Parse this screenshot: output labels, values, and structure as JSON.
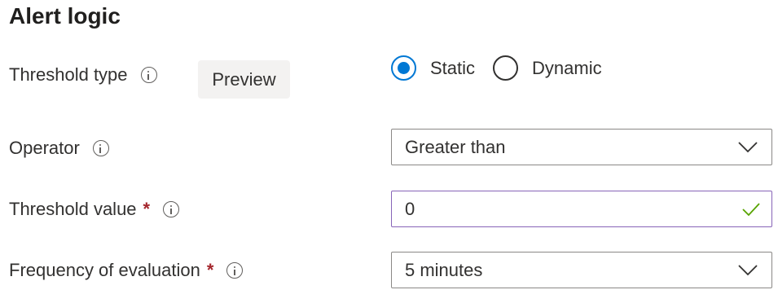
{
  "title": "Alert logic",
  "threshold_type": {
    "label": "Threshold type",
    "info_icon": "info-icon",
    "badge": "Preview",
    "options": [
      {
        "label": "Static",
        "selected": true
      },
      {
        "label": "Dynamic",
        "selected": false
      }
    ]
  },
  "operator": {
    "label": "Operator",
    "info_icon": "info-icon",
    "value": "Greater than",
    "dropdown_icon": "chevron-down-icon"
  },
  "threshold_value": {
    "label": "Threshold value",
    "required_marker": "*",
    "info_icon": "info-icon",
    "value": "0",
    "status_icon": "checkmark-icon"
  },
  "frequency": {
    "label": "Frequency of evaluation",
    "required_marker": "*",
    "info_icon": "info-icon",
    "value": "5 minutes",
    "dropdown_icon": "chevron-down-icon"
  },
  "colors": {
    "accent": "#0078d4",
    "required": "#a4262c",
    "valid_border": "#8764b8",
    "valid_check": "#57a300"
  }
}
